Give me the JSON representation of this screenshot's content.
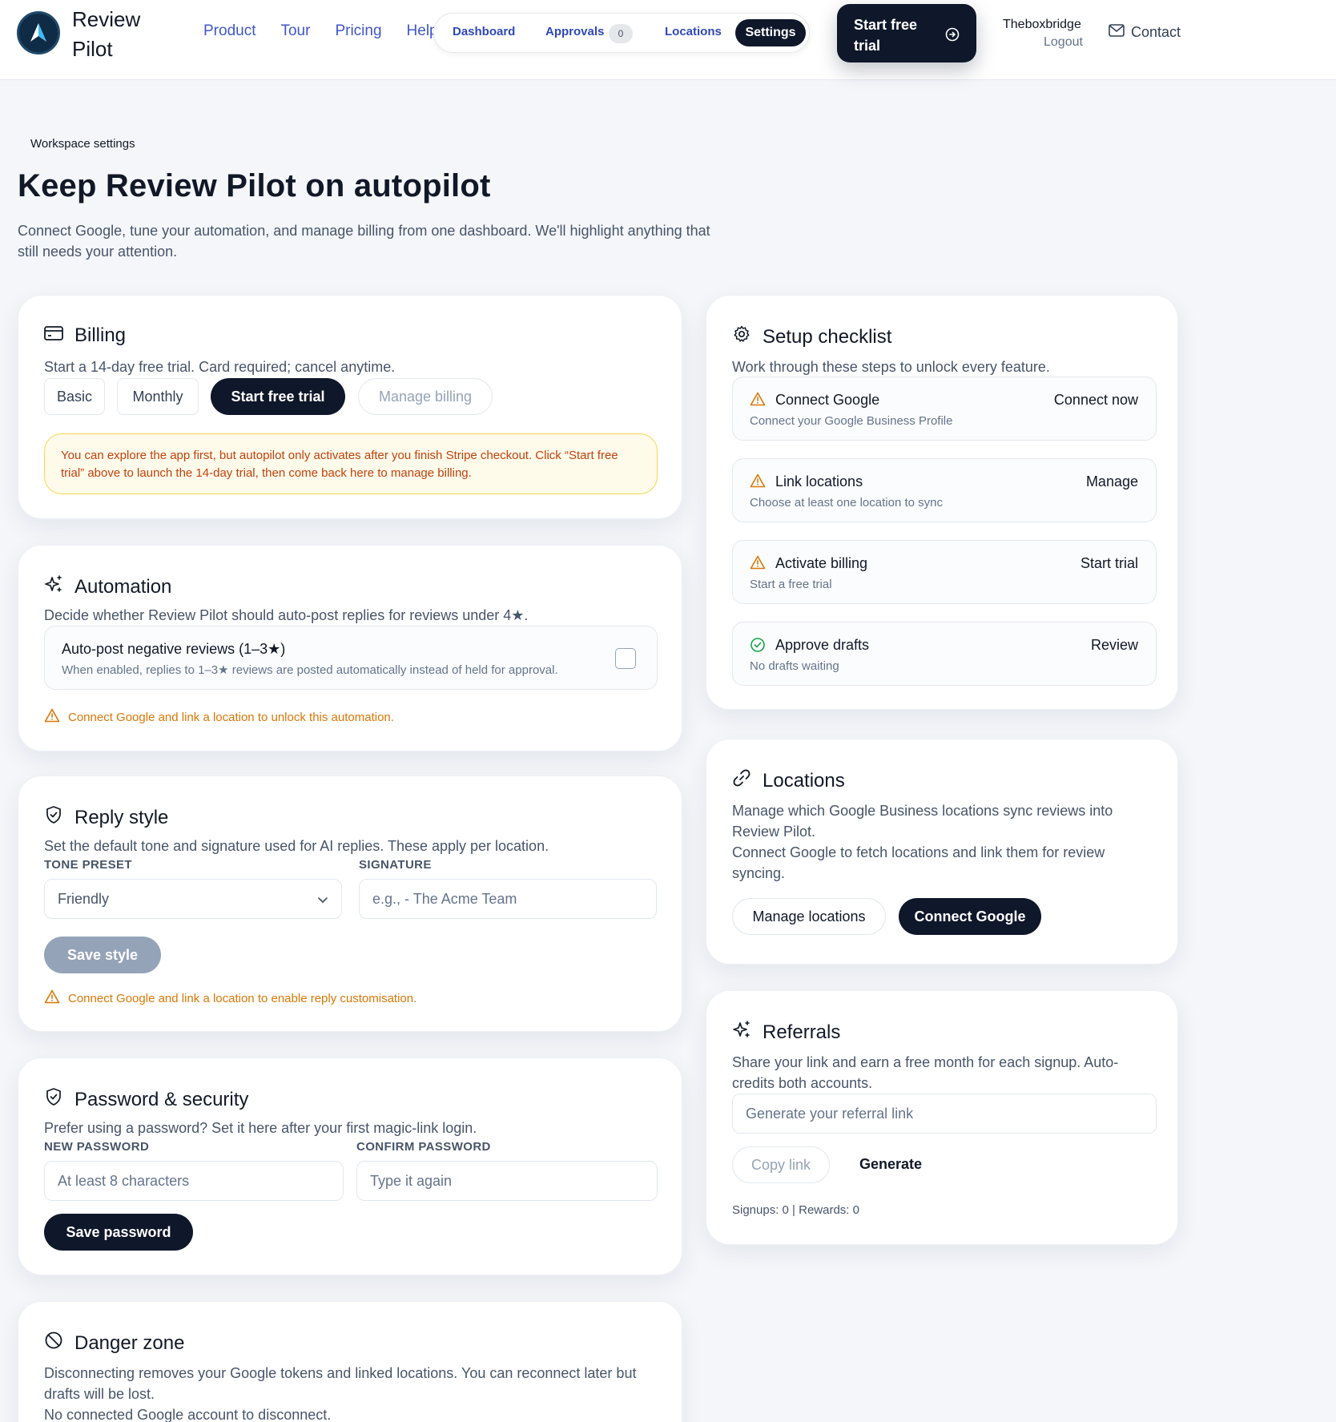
{
  "brand": {
    "name": "Review Pilot"
  },
  "nav": {
    "links": [
      "Product",
      "Tour",
      "Pricing",
      "Help"
    ],
    "pill": {
      "dashboard": "Dashboard",
      "approvals": "Approvals",
      "approvals_count": "0",
      "locations": "Locations",
      "settings": "Settings"
    },
    "trial_button": "Start free trial",
    "user": {
      "name": "Theboxbridge",
      "logout": "Logout"
    },
    "contact": "Contact"
  },
  "intro": {
    "eyebrow": "Workspace settings",
    "title": "Keep Review Pilot on autopilot",
    "subtitle": "Connect Google, tune your automation, and manage billing from one dashboard. We'll highlight anything that still needs your attention."
  },
  "billing": {
    "title": "Billing",
    "desc": "Start a 14-day free trial. Card required; cancel anytime.",
    "plan_select": "Basic",
    "interval_select": "Monthly",
    "start_trial": "Start free trial",
    "manage_billing": "Manage billing",
    "notice": "You can explore the app first, but autopilot only activates after you finish Stripe checkout. Click “Start free trial” above to launch the 14-day trial, then come back here to manage billing."
  },
  "automation": {
    "title": "Automation",
    "desc": "Decide whether Review Pilot should auto-post replies for reviews under 4★.",
    "toggle_title": "Auto-post negative reviews (1–3★)",
    "toggle_desc": "When enabled, replies to 1–3★ reviews are posted automatically instead of held for approval.",
    "checked": false,
    "warning": "Connect Google and link a location to unlock this automation."
  },
  "reply_style": {
    "title": "Reply style",
    "desc": "Set the default tone and signature used for AI replies. These apply per location.",
    "tone_label": "TONE PRESET",
    "tone_value": "Friendly",
    "signature_label": "SIGNATURE",
    "signature_placeholder": "e.g., - The Acme Team",
    "save": "Save style",
    "warning": "Connect Google and link a location to enable reply customisation."
  },
  "password": {
    "title": "Password & security",
    "desc": "Prefer using a password? Set it here after your first magic-link login.",
    "new_label": "NEW PASSWORD",
    "new_placeholder": "At least 8 characters",
    "confirm_label": "CONFIRM PASSWORD",
    "confirm_placeholder": "Type it again",
    "save": "Save password"
  },
  "danger": {
    "title": "Danger zone",
    "desc": "Disconnecting removes your Google tokens and linked locations. You can reconnect later but drafts will be lost.",
    "status": "No connected Google account to disconnect."
  },
  "checklist": {
    "title": "Setup checklist",
    "desc": "Work through these steps to unlock every feature.",
    "items": [
      {
        "title": "Connect Google",
        "sub": "Connect your Google Business Profile",
        "action": "Connect now",
        "icon": "warning-icon"
      },
      {
        "title": "Link locations",
        "sub": "Choose at least one location to sync",
        "action": "Manage",
        "icon": "warning-icon"
      },
      {
        "title": "Activate billing",
        "sub": "Start a free trial",
        "action": "Start trial",
        "icon": "warning-icon"
      },
      {
        "title": "Approve drafts",
        "sub": "No drafts waiting",
        "action": "Review",
        "icon": "check-circle-icon"
      }
    ]
  },
  "locations": {
    "title": "Locations",
    "desc1": "Manage which Google Business locations sync reviews into Review Pilot.",
    "desc2": "Connect Google to fetch locations and link them for review syncing.",
    "manage": "Manage locations",
    "connect": "Connect Google"
  },
  "referrals": {
    "title": "Referrals",
    "desc": "Share your link and earn a free month for each signup. Auto-credits both accounts.",
    "link_placeholder": "Generate your referral link",
    "copy": "Copy link",
    "generate": "Generate",
    "stats": "Signups: 0 | Rewards: 0"
  },
  "colors": {
    "accent_dark": "#0f172a",
    "link_blue": "#3f56c9",
    "warning": "#d97706",
    "success": "#16a34a",
    "notice_bg": "#fffbeb"
  }
}
